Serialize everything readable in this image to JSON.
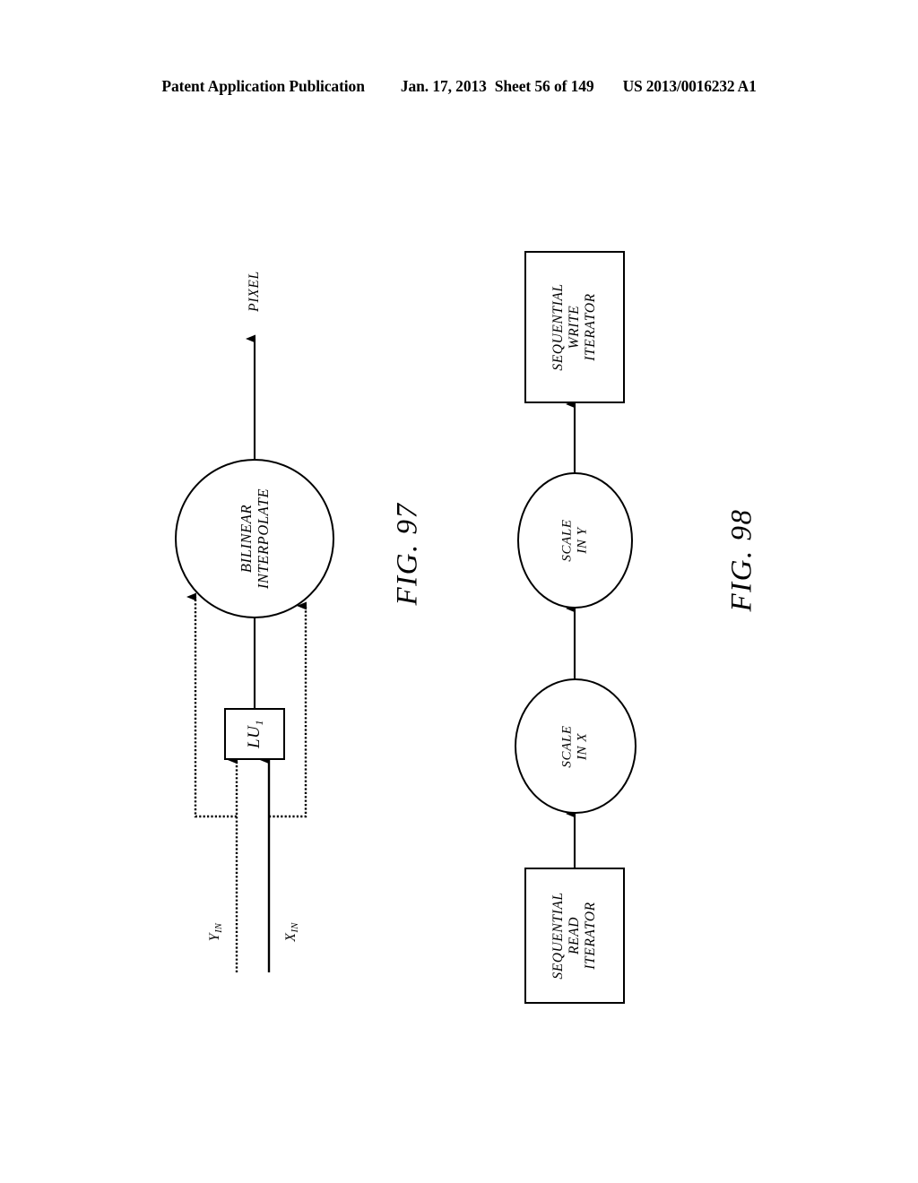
{
  "header": {
    "publication": "Patent Application Publication",
    "date": "Jan. 17, 2013",
    "sheet": "Sheet 56 of 149",
    "patent_number": "US 2013/0016232 A1"
  },
  "figures": [
    {
      "id": "fig-97",
      "caption": "FIG. 97",
      "nodes": {
        "interpolate_circle": {
          "label_lines": [
            "BILINEAR",
            "INTERPOLATE"
          ],
          "shape": "circle"
        },
        "lookup_box": {
          "label": "LU",
          "label_subscript": "1",
          "shape": "box"
        }
      },
      "io": {
        "output": "PIXEL",
        "input_y": "Y",
        "input_y_sub": "IN",
        "input_x": "X",
        "input_x_sub": "IN"
      }
    },
    {
      "id": "fig-98",
      "caption": "FIG. 98",
      "nodes": {
        "write_iterator_box": {
          "label_lines": [
            "SEQUENTIAL",
            "WRITE",
            "ITERATOR"
          ],
          "shape": "box"
        },
        "scale_y_circle": {
          "label_lines": [
            "SCALE",
            "IN Y"
          ],
          "shape": "circle"
        },
        "scale_x_circle": {
          "label_lines": [
            "SCALE",
            "IN X"
          ],
          "shape": "circle"
        },
        "read_iterator_box": {
          "label_lines": [
            "SEQUENTIAL",
            "READ",
            "ITERATOR"
          ],
          "shape": "box"
        }
      }
    }
  ],
  "colors": {
    "ink": "#000000",
    "paper": "#ffffff"
  }
}
